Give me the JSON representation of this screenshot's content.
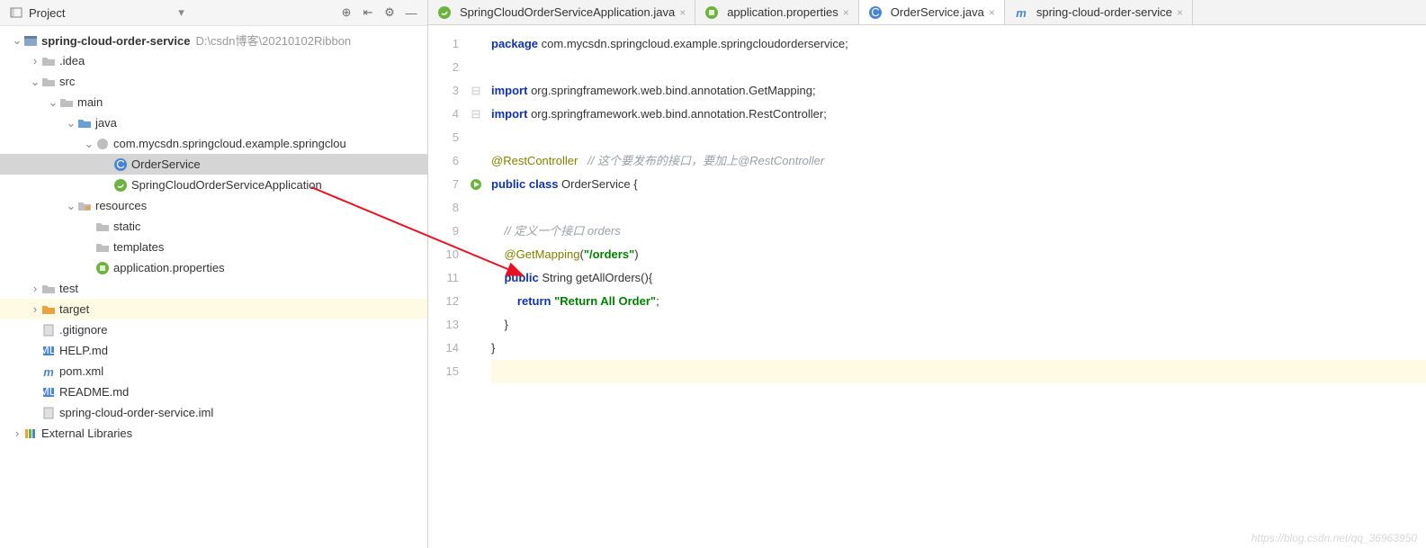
{
  "sidebar": {
    "title": "Project",
    "dropdown": "▾",
    "tree": [
      {
        "depth": 0,
        "twisty": "down",
        "icon": "module",
        "label": "spring-cloud-order-service",
        "bold": true,
        "suffix": "D:\\csdn博客\\20210102Ribbon"
      },
      {
        "depth": 1,
        "twisty": "right",
        "icon": "folder-gray",
        "label": ".idea"
      },
      {
        "depth": 1,
        "twisty": "down",
        "icon": "folder-gray",
        "label": "src"
      },
      {
        "depth": 2,
        "twisty": "down",
        "icon": "folder-gray",
        "label": "main"
      },
      {
        "depth": 3,
        "twisty": "down",
        "icon": "folder-blue",
        "label": "java"
      },
      {
        "depth": 4,
        "twisty": "down",
        "icon": "package",
        "label": "com.mycsdn.springcloud.example.springclou"
      },
      {
        "depth": 5,
        "twisty": "blank",
        "icon": "class",
        "label": "OrderService",
        "sel": true
      },
      {
        "depth": 5,
        "twisty": "blank",
        "icon": "spring",
        "label": "SpringCloudOrderServiceApplication"
      },
      {
        "depth": 3,
        "twisty": "down",
        "icon": "resources",
        "label": "resources"
      },
      {
        "depth": 4,
        "twisty": "blank",
        "icon": "folder-gray",
        "label": "static"
      },
      {
        "depth": 4,
        "twisty": "blank",
        "icon": "folder-gray",
        "label": "templates"
      },
      {
        "depth": 4,
        "twisty": "blank",
        "icon": "props",
        "label": "application.properties"
      },
      {
        "depth": 1,
        "twisty": "right",
        "icon": "folder-gray",
        "label": "test"
      },
      {
        "depth": 1,
        "twisty": "right",
        "icon": "folder-orange",
        "label": "target",
        "hl": true
      },
      {
        "depth": 1,
        "twisty": "blank",
        "icon": "file",
        "label": ".gitignore"
      },
      {
        "depth": 1,
        "twisty": "blank",
        "icon": "md",
        "label": "HELP.md"
      },
      {
        "depth": 1,
        "twisty": "blank",
        "icon": "maven",
        "label": "pom.xml"
      },
      {
        "depth": 1,
        "twisty": "blank",
        "icon": "md",
        "label": "README.md"
      },
      {
        "depth": 1,
        "twisty": "blank",
        "icon": "file",
        "label": "spring-cloud-order-service.iml"
      },
      {
        "depth": 0,
        "twisty": "right",
        "icon": "libs",
        "label": "External Libraries"
      }
    ]
  },
  "tabs": [
    {
      "icon": "spring",
      "label": "SpringCloudOrderServiceApplication.java",
      "active": false
    },
    {
      "icon": "props",
      "label": "application.properties",
      "active": false
    },
    {
      "icon": "class",
      "label": "OrderService.java",
      "active": true
    },
    {
      "icon": "maven",
      "label": "spring-cloud-order-service",
      "active": false
    }
  ],
  "code": {
    "lines": [
      {
        "n": 1,
        "html": "<span class='kw'>package</span> com.mycsdn.springcloud.example.springcloudorderservice;"
      },
      {
        "n": 2,
        "html": ""
      },
      {
        "n": 3,
        "html": "<span class='kw'>import</span> org.springframework.web.bind.annotation.<span class='cls'>GetMapping</span>;",
        "fold": true
      },
      {
        "n": 4,
        "html": "<span class='kw'>import</span> org.springframework.web.bind.annotation.<span class='cls'>RestController</span>;",
        "fold": true
      },
      {
        "n": 5,
        "html": ""
      },
      {
        "n": 6,
        "html": "<span class='ann'>@RestController</span>   <span class='cmt'>// 这个要发布的接口，要加上@RestController</span>"
      },
      {
        "n": 7,
        "html": "<span class='kw'>public class</span> OrderService {",
        "mark": "run"
      },
      {
        "n": 8,
        "html": ""
      },
      {
        "n": 9,
        "html": "    <span class='cmt'>// 定义一个接口 orders</span>"
      },
      {
        "n": 10,
        "html": "    <span class='ann'>@GetMapping</span>(<span class='str'>\"/orders\"</span>)"
      },
      {
        "n": 11,
        "html": "    <span class='kw'>public</span> String getAllOrders(){"
      },
      {
        "n": 12,
        "html": "        <span class='kw'>return</span> <span class='str'>\"Return All Order\"</span>;"
      },
      {
        "n": 13,
        "html": "    }"
      },
      {
        "n": 14,
        "html": "}"
      },
      {
        "n": 15,
        "html": "",
        "cursor": true
      }
    ]
  },
  "watermark": "https://blog.csdn.net/qq_36963950"
}
